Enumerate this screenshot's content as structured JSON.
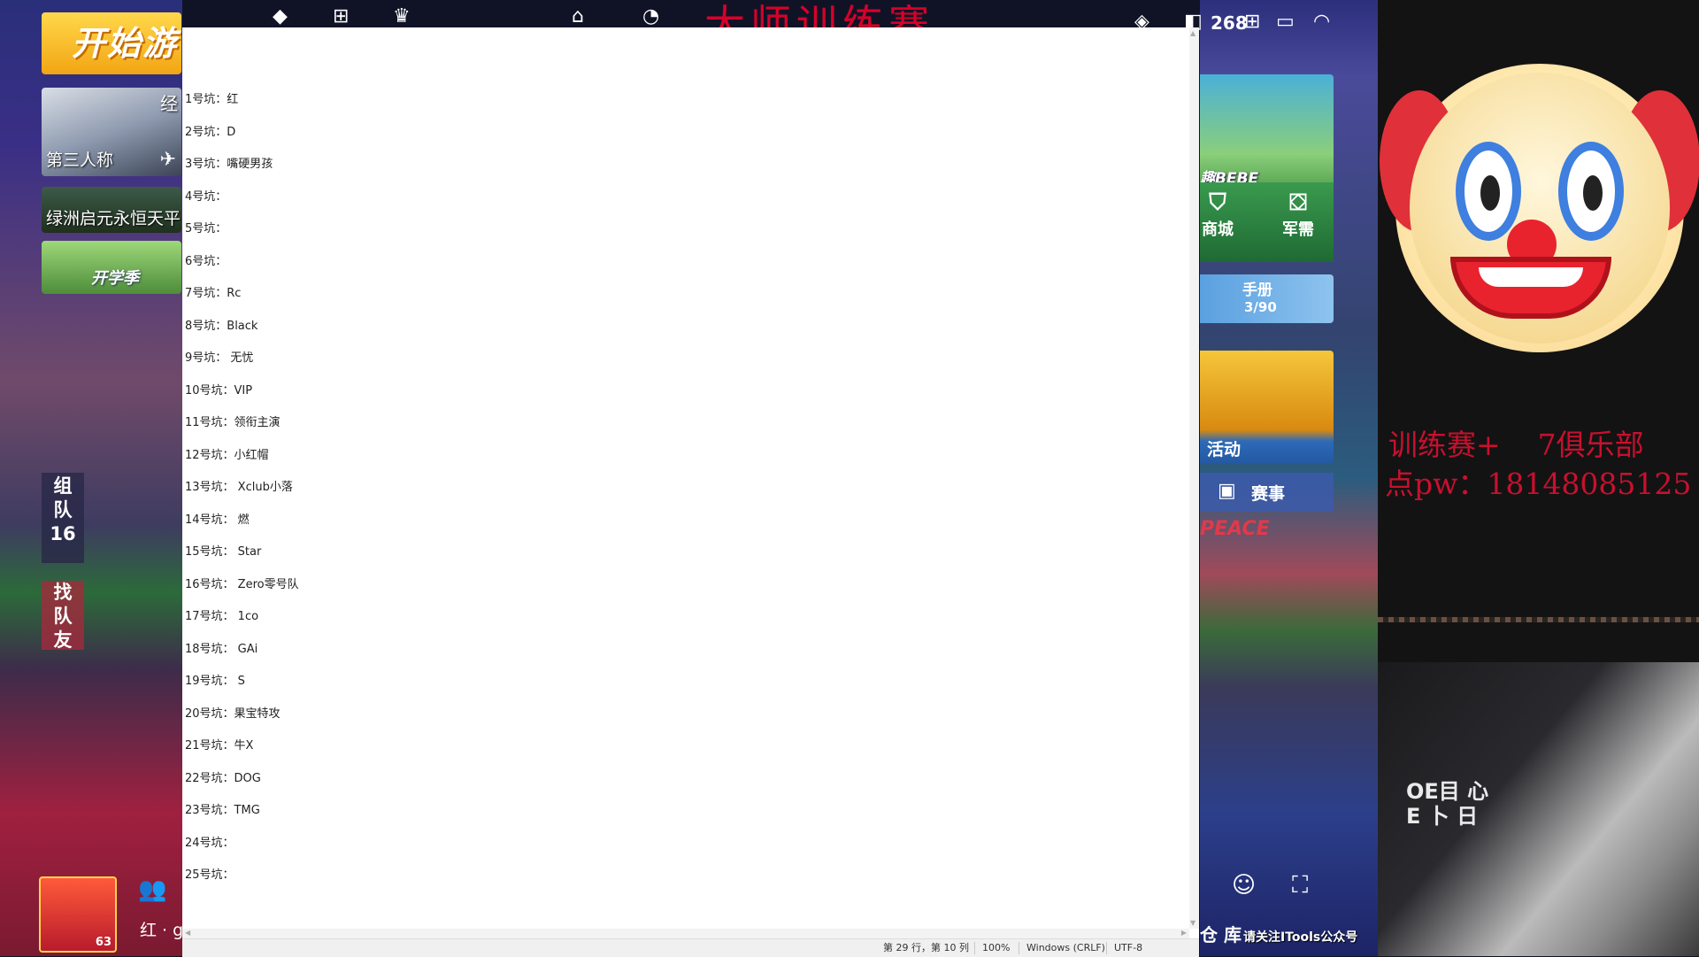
{
  "game": {
    "start_label": "开始游",
    "mode_label": "第三人称",
    "mode_corner": "经",
    "map_label": "绿洲启元永恒天平",
    "event_label": "开学季",
    "team_label": [
      "组",
      "队",
      "16"
    ],
    "find_team_label": [
      "找",
      "队",
      "友"
    ],
    "avatar_level": "63",
    "player_tag": "红 · g",
    "banner_title": "大师训练赛",
    "status_number": "268",
    "bebe_label": "趣BEBE",
    "shop_label": "商城",
    "supply_label": "军需",
    "handbook_label": "手册",
    "handbook_progress": "3/90",
    "activity_label": "活动",
    "match_label": "赛事",
    "peace_text": "PEACE",
    "warehouse_label": "仓 库",
    "follow_note": "请关注ITools公众号"
  },
  "notepad": {
    "lines": [
      "1号坑：红",
      "2号坑：D",
      "3号坑：嘴硬男孩",
      "4号坑：",
      "5号坑：",
      "6号坑：",
      "7号坑：Rc",
      "8号坑：Black",
      "9号坑： 无忧",
      "10号坑：VIP",
      "11号坑：领衔主演",
      "12号坑：小红帽",
      "13号坑： Xclub小落",
      "14号坑： 燃",
      "15号坑： Star",
      "16号坑： Zero零号队",
      "17号坑： 1co",
      "18号坑： GAi",
      "19号坑： S",
      "20号坑：果宝特攻",
      "21号坑：牛X",
      "22号坑：DOG",
      "23号坑：TMG",
      "24号坑：",
      "25号坑："
    ],
    "status": {
      "position": "第 29 行，第 10 列",
      "zoom": "100%",
      "line_ending": "Windows (CRLF)",
      "encoding": "UTF-8"
    }
  },
  "stream": {
    "promo_line1": "训练赛+    7俱乐部",
    "promo_line2": "点pw：18148085125",
    "shirt_text": "OE目 心\nE 卜 日"
  },
  "colors": {
    "banner_red": "#d8002a",
    "promo_red": "#c8102e"
  }
}
